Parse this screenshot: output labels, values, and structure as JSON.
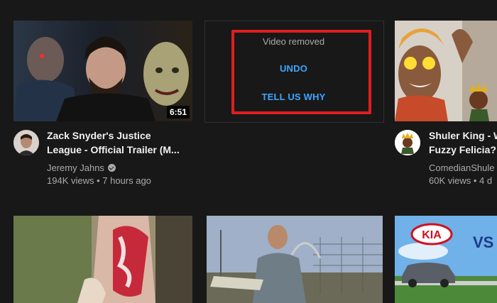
{
  "videos": [
    {
      "title_line1": "Zack Snyder's Justice",
      "title_line2": "League - Official Trailer (M...",
      "channel": "Jeremy Jahns",
      "stats": "194K views • 7 hours ago",
      "duration": "6:51"
    },
    {
      "title_line1": "Shuler King - W",
      "title_line2": "Fuzzy Felicia?!",
      "channel": "ComedianShule",
      "stats": "60K views • 4 d"
    }
  ],
  "removed": {
    "message": "Video removed",
    "undo_label": "UNDO",
    "tell_why_label": "TELL US WHY"
  },
  "row2": {
    "vs_text": "VS",
    "kia_text": "KIA"
  },
  "colors": {
    "background": "#181818",
    "link_blue": "#3ea6ff",
    "highlight_red": "#e01e1e"
  }
}
